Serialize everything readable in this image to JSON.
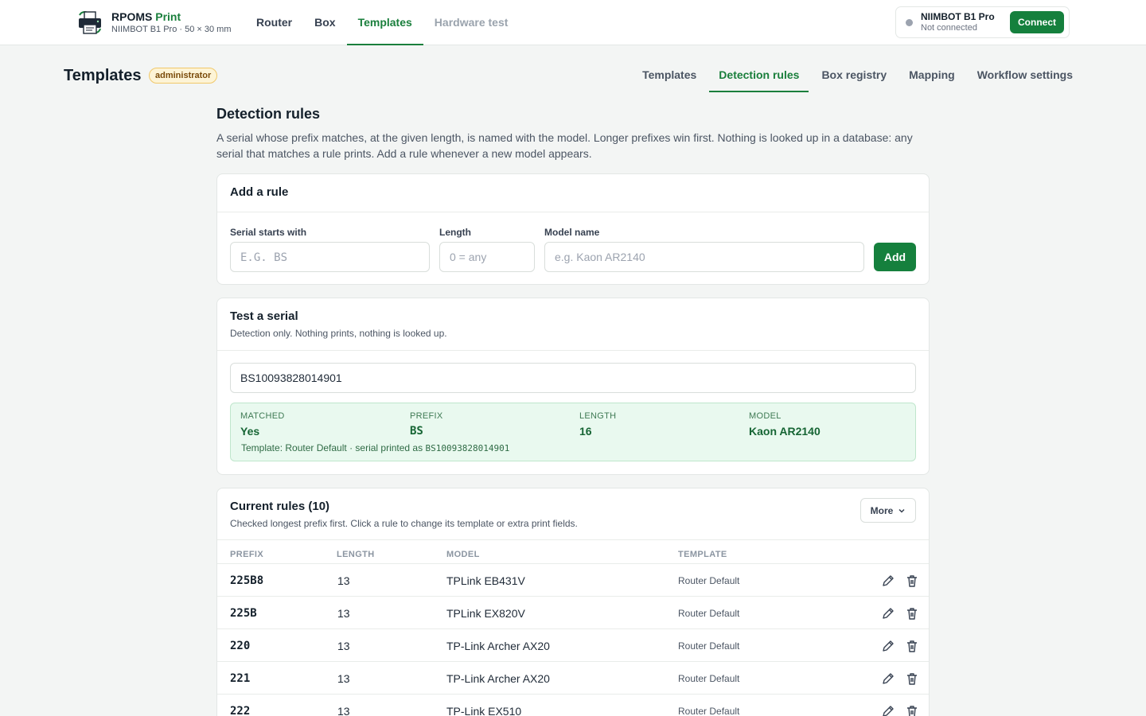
{
  "brand": {
    "name": "RPOMS",
    "name_accent": "Print",
    "subtitle": "NIIMBOT B1 Pro · 50 × 30 mm"
  },
  "main_nav": [
    {
      "label": "Router"
    },
    {
      "label": "Box"
    },
    {
      "label": "Templates",
      "active": true
    },
    {
      "label": "Hardware test",
      "muted": true
    }
  ],
  "printer": {
    "name": "NIIMBOT B1 Pro",
    "status": "Not connected",
    "connect_label": "Connect"
  },
  "page": {
    "title": "Templates",
    "role_badge": "administrator"
  },
  "sub_nav": [
    {
      "label": "Templates"
    },
    {
      "label": "Detection rules",
      "active": true
    },
    {
      "label": "Box registry"
    },
    {
      "label": "Mapping"
    },
    {
      "label": "Workflow settings"
    }
  ],
  "detection": {
    "title": "Detection rules",
    "description": "A serial whose prefix matches, at the given length, is named with the model. Longer prefixes win first. Nothing is looked up in a database: any serial that matches a rule prints. Add a rule whenever a new model appears."
  },
  "add_rule": {
    "title": "Add a rule",
    "prefix_label": "Serial starts with",
    "prefix_placeholder": "E.G. BS",
    "length_label": "Length",
    "length_placeholder": "0 = any",
    "model_label": "Model name",
    "model_placeholder": "e.g. Kaon AR2140",
    "add_label": "Add"
  },
  "test_serial": {
    "title": "Test a serial",
    "subtitle": "Detection only. Nothing prints, nothing is looked up.",
    "value": "BS10093828014901",
    "result": {
      "matched_label": "MATCHED",
      "matched_value": "Yes",
      "prefix_label": "PREFIX",
      "prefix_value": "BS",
      "length_label": "LENGTH",
      "length_value": "16",
      "model_label": "MODEL",
      "model_value": "Kaon AR2140",
      "note_text": "Template: Router Default · serial printed as ",
      "note_serial": "BS10093828014901"
    }
  },
  "rules": {
    "title": "Current rules (10)",
    "subtitle": "Checked longest prefix first. Click a rule to change its template or extra print fields.",
    "more_label": "More",
    "columns": {
      "prefix": "PREFIX",
      "length": "LENGTH",
      "model": "MODEL",
      "template": "TEMPLATE"
    },
    "rows": [
      {
        "prefix": "225B8",
        "length": "13",
        "model": "TPLink EB431V",
        "template": "Router Default"
      },
      {
        "prefix": "225B",
        "length": "13",
        "model": "TPLink EX820V",
        "template": "Router Default"
      },
      {
        "prefix": "220",
        "length": "13",
        "model": "TP-Link Archer AX20",
        "template": "Router Default"
      },
      {
        "prefix": "221",
        "length": "13",
        "model": "TP-Link Archer AX20",
        "template": "Router Default"
      },
      {
        "prefix": "222",
        "length": "13",
        "model": "TP-Link EX510",
        "template": "Router Default"
      }
    ]
  },
  "colors": {
    "accent": "#15803d",
    "badge_bg": "#fdf4d6",
    "result_bg": "#e9f9ef"
  },
  "icons": [
    "printer-logo-icon",
    "status-dot-icon",
    "chevron-down-icon",
    "pencil-icon",
    "trash-icon"
  ]
}
